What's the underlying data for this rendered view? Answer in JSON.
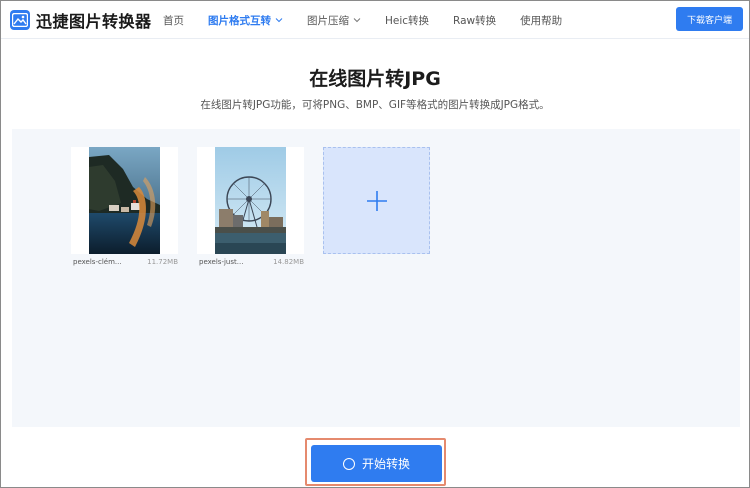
{
  "header": {
    "logo_text": "迅捷图片转换器",
    "nav": [
      {
        "label": "首页"
      },
      {
        "label": "图片格式互转",
        "has_dropdown": true,
        "active": true
      },
      {
        "label": "图片压缩",
        "has_dropdown": true
      },
      {
        "label": "Heic转换"
      },
      {
        "label": "Raw转换"
      },
      {
        "label": "使用帮助"
      }
    ],
    "download_label": "下载客户端"
  },
  "main": {
    "title": "在线图片转JPG",
    "subtitle": "在线图片转JPG功能，可将PNG、BMP、GIF等格式的图片转换成JPG格式。"
  },
  "files": [
    {
      "name": "pexels-clém...",
      "size": "11.72MB"
    },
    {
      "name": "pexels-just...",
      "size": "14.82MB"
    }
  ],
  "add_icon": "plus-icon",
  "start_button": {
    "label": "开始转换",
    "icon": "spinner-icon"
  },
  "colors": {
    "accent": "#2f7cf0",
    "upload_bg": "#f4f7fb",
    "add_card_bg": "#d9e5fc",
    "highlight_outline": "#e58a6e"
  }
}
